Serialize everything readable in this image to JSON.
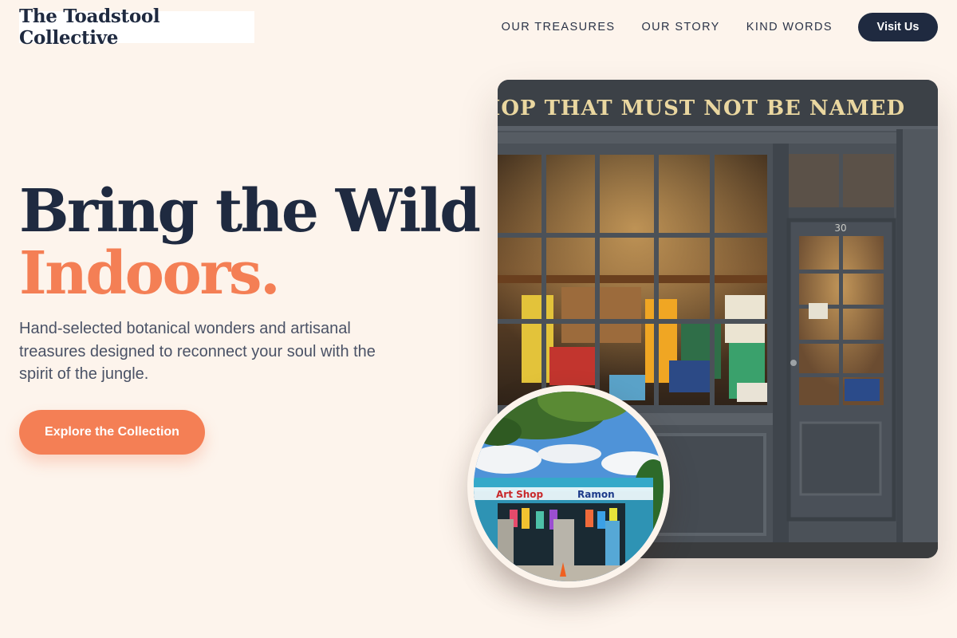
{
  "brand": {
    "name": "The Toadstool Collective"
  },
  "nav": {
    "links": [
      "OUR TREASURES",
      "OUR STORY",
      "KIND WORDS"
    ],
    "visit_label": "Visit Us"
  },
  "hero": {
    "title_line1": "Bring the Wild",
    "title_line2": "Indoors.",
    "subtitle": "Hand-selected botanical wonders and artisanal treasures designed to reconnect your soul with the spirit of the jungle.",
    "cta_label": "Explore the Collection"
  },
  "images": {
    "main": {
      "sign_text": "SHOP THAT MUST NOT BE NAMED",
      "door_number": "30"
    },
    "inset": {
      "sign_text": "Art Shop",
      "sign_text_2": "Ramon"
    }
  },
  "colors": {
    "background": "#fdf4ec",
    "navy": "#1f2a40",
    "accent": "#f47f55",
    "body_text": "#4a5266"
  }
}
